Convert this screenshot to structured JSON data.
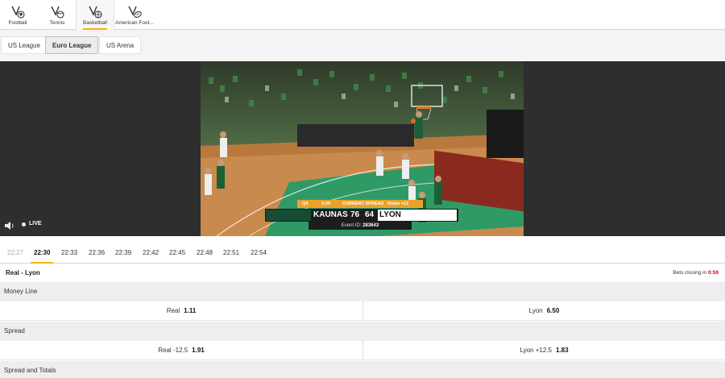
{
  "sports": [
    {
      "label": "Football",
      "icon": "football-icon"
    },
    {
      "label": "Tennis",
      "icon": "tennis-icon"
    },
    {
      "label": "Basketball",
      "icon": "basketball-icon",
      "active": true
    },
    {
      "label": "American Foot...",
      "icon": "american-football-icon"
    }
  ],
  "leagues": [
    {
      "label": "US League"
    },
    {
      "label": "Euro League",
      "active": true
    },
    {
      "label": "US Arena"
    }
  ],
  "video": {
    "live_label": "LIVE",
    "scoreboard": {
      "quarter": "Q4",
      "clock": "2:09",
      "spread_label": "CURRENT SPREAD",
      "spread_value": "Home +12",
      "home_team": "KAUNAS",
      "home_score": "76",
      "away_score": "64",
      "away_team": "LYON",
      "event_label": "Event ID:",
      "event_id": "283643"
    }
  },
  "times": [
    {
      "label": "22:27",
      "state": "past"
    },
    {
      "label": "22:30",
      "state": "active"
    },
    {
      "label": "22:33"
    },
    {
      "label": "22:36"
    },
    {
      "label": "22:39"
    },
    {
      "label": "22:42"
    },
    {
      "label": "22:45"
    },
    {
      "label": "22:48"
    },
    {
      "label": "22:51"
    },
    {
      "label": "22:54"
    }
  ],
  "match": {
    "title": "Real - Lyon",
    "closing_label": "Bets closing in",
    "closing_time": "0:59"
  },
  "markets": [
    {
      "title": "Money Line",
      "odds": [
        {
          "label": "Real",
          "value": "1.11"
        },
        {
          "label": "Lyon",
          "value": "6.50"
        }
      ]
    },
    {
      "title": "Spread",
      "odds": [
        {
          "label": "Real -12.5",
          "value": "1.91"
        },
        {
          "label": "Lyon +12.5",
          "value": "1.83"
        }
      ]
    },
    {
      "title": "Spread and Totals",
      "odds": []
    }
  ],
  "colors": {
    "accent": "#f2b600",
    "live_red": "#d0021b",
    "score_orange": "#e9a32a"
  }
}
